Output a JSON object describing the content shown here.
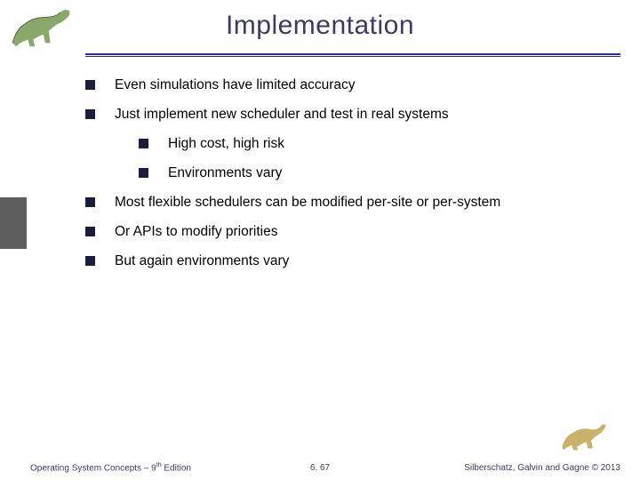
{
  "title": "Implementation",
  "bullets": [
    {
      "level": 0,
      "text": "Even simulations have limited accuracy"
    },
    {
      "level": 0,
      "text": "Just implement new scheduler and test in real systems"
    },
    {
      "level": 1,
      "text": "High cost, high risk"
    },
    {
      "level": 1,
      "text": "Environments vary"
    },
    {
      "level": 0,
      "text": "Most flexible schedulers can be modified per-site or per-system"
    },
    {
      "level": 0,
      "text": "Or APIs to modify priorities"
    },
    {
      "level": 0,
      "text": "But again environments vary"
    }
  ],
  "footer": {
    "left_a": "Operating System Concepts – 9",
    "left_sup": "th",
    "left_b": " Edition",
    "center": "6. 67",
    "right": "Silberschatz, Galvin and Gagne © 2013"
  }
}
